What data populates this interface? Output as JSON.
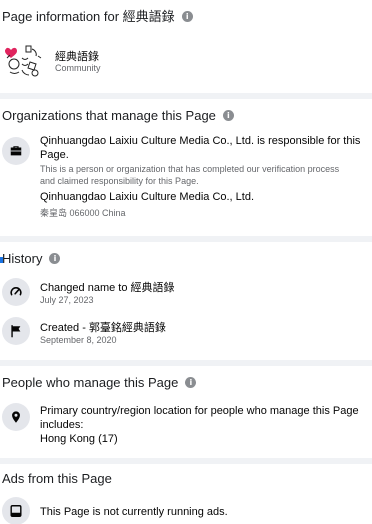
{
  "header": {
    "title": "Page information for 經典語錄",
    "page_name": "經典語錄",
    "page_category": "Community"
  },
  "organizations": {
    "title": "Organizations that manage this Page",
    "responsible_text": "Qinhuangdao Laixiu Culture Media Co., Ltd. is responsible for this Page.",
    "description": "This is a person or organization that has completed our verification process and claimed responsibility for this Page.",
    "org_name": "Qinhuangdao Laixiu Culture Media Co., Ltd.",
    "org_address": "秦皇岛 066000 China"
  },
  "history": {
    "title": "History",
    "items": [
      {
        "label": "Changed name to 經典語錄",
        "date": "July 27, 2023",
        "icon": "edit-icon"
      },
      {
        "label": "Created - 郭臺銘經典語錄",
        "date": "September 8, 2020",
        "icon": "flag-icon"
      }
    ]
  },
  "people": {
    "title": "People who manage this Page",
    "text": "Primary country/region location for people who manage this Page includes:",
    "location": "Hong Kong (17)"
  },
  "ads": {
    "title": "Ads from this Page",
    "text": "This Page is not currently running ads."
  },
  "icons": {
    "info": "info-icon",
    "briefcase": "briefcase-icon",
    "location": "location-pin-icon",
    "ads": "ad-icon"
  },
  "colors": {
    "background": "#f0f2f5",
    "card": "#ffffff",
    "icon_circle": "#e4e6eb",
    "secondary_text": "#65676b"
  }
}
